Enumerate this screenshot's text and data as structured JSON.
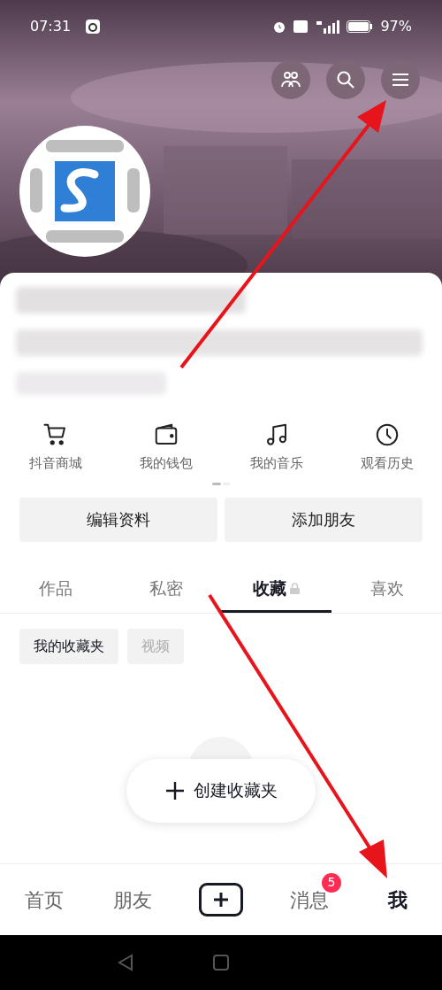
{
  "status_bar": {
    "time": "07:31",
    "battery": "97%"
  },
  "shortcuts": [
    {
      "kind": "cart",
      "label": "抖音商城"
    },
    {
      "kind": "wallet",
      "label": "我的钱包"
    },
    {
      "kind": "music",
      "label": "我的音乐"
    },
    {
      "kind": "clock",
      "label": "观看历史"
    }
  ],
  "profile_buttons": [
    "编辑资料",
    "添加朋友"
  ],
  "tabs": [
    {
      "label": "作品",
      "selected": false,
      "locked": false
    },
    {
      "label": "私密",
      "selected": false,
      "locked": false
    },
    {
      "label": "收藏",
      "selected": true,
      "locked": true
    },
    {
      "label": "喜欢",
      "selected": false,
      "locked": false
    }
  ],
  "chips": [
    {
      "label": "我的收藏夹",
      "selected": true
    },
    {
      "label": "视频",
      "selected": false
    }
  ],
  "create_button": {
    "label": "创建收藏夹"
  },
  "nav": [
    {
      "kind": "text",
      "label": "首页",
      "selected": false
    },
    {
      "kind": "text",
      "label": "朋友",
      "selected": false
    },
    {
      "kind": "plus",
      "selected": false
    },
    {
      "kind": "text",
      "label": "消息",
      "selected": false,
      "badge": "5"
    },
    {
      "kind": "text",
      "label": "我",
      "selected": true
    }
  ]
}
